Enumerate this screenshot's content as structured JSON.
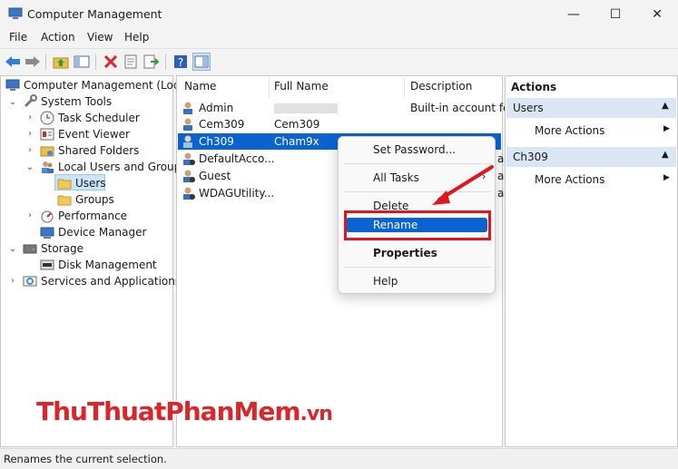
{
  "window": {
    "title": "Computer Management",
    "controls": {
      "minimize": "—",
      "maximize": "☐",
      "close": "✕"
    }
  },
  "menu": {
    "items": [
      "File",
      "Action",
      "View",
      "Help"
    ]
  },
  "toolbar": {
    "icons": [
      "back-arrow-icon",
      "forward-arrow-icon",
      "up-folder-icon",
      "show-hide-tree-icon",
      "delete-icon",
      "properties-icon",
      "export-icon",
      "help-icon",
      "show-hide-action-pane-icon"
    ]
  },
  "tree": {
    "items": [
      {
        "label": "Computer Management (Local",
        "icon": "computer-icon"
      },
      {
        "label": "System Tools",
        "icon": "tools-icon"
      },
      {
        "label": "Task Scheduler",
        "icon": "clock-icon"
      },
      {
        "label": "Event Viewer",
        "icon": "event-viewer-icon"
      },
      {
        "label": "Shared Folders",
        "icon": "shared-folder-icon"
      },
      {
        "label": "Local Users and Groups",
        "icon": "users-groups-icon"
      },
      {
        "label": "Users",
        "icon": "folder-icon"
      },
      {
        "label": "Groups",
        "icon": "folder-icon"
      },
      {
        "label": "Performance",
        "icon": "performance-icon"
      },
      {
        "label": "Device Manager",
        "icon": "device-manager-icon"
      },
      {
        "label": "Storage",
        "icon": "storage-icon"
      },
      {
        "label": "Disk Management",
        "icon": "disk-icon"
      },
      {
        "label": "Services and Applications",
        "icon": "services-icon"
      }
    ]
  },
  "list": {
    "columns": [
      "Name",
      "Full Name",
      "Description"
    ],
    "rows": [
      {
        "name": "Admin",
        "full_name": "",
        "description": "Built-in account fo"
      },
      {
        "name": "Cem309",
        "full_name": "Cem309",
        "description": ""
      },
      {
        "name": "Ch309",
        "full_name": "Cham9x",
        "description": ""
      },
      {
        "name": "DefaultAcco...",
        "full_name": "",
        "description": "a"
      },
      {
        "name": "Guest",
        "full_name": "",
        "description": "a"
      },
      {
        "name": "WDAGUtility...",
        "full_name": "",
        "description": "a"
      }
    ],
    "selected_row": "Ch309"
  },
  "context_menu": {
    "set_password": "Set Password...",
    "all_tasks": "All Tasks",
    "delete": "Delete",
    "rename": "Rename",
    "properties": "Properties",
    "help": "Help",
    "highlight_color": "#e0161e",
    "selection_color": "#0b63d0"
  },
  "actions": {
    "header": "Actions",
    "sections": [
      {
        "title": "Users",
        "more": "More Actions"
      },
      {
        "title": "Ch309",
        "more": "More Actions"
      }
    ]
  },
  "status": {
    "text": "Renames the current selection."
  },
  "watermark": {
    "part1": "ThuThuatPhanMem",
    "part2": ".vn"
  }
}
